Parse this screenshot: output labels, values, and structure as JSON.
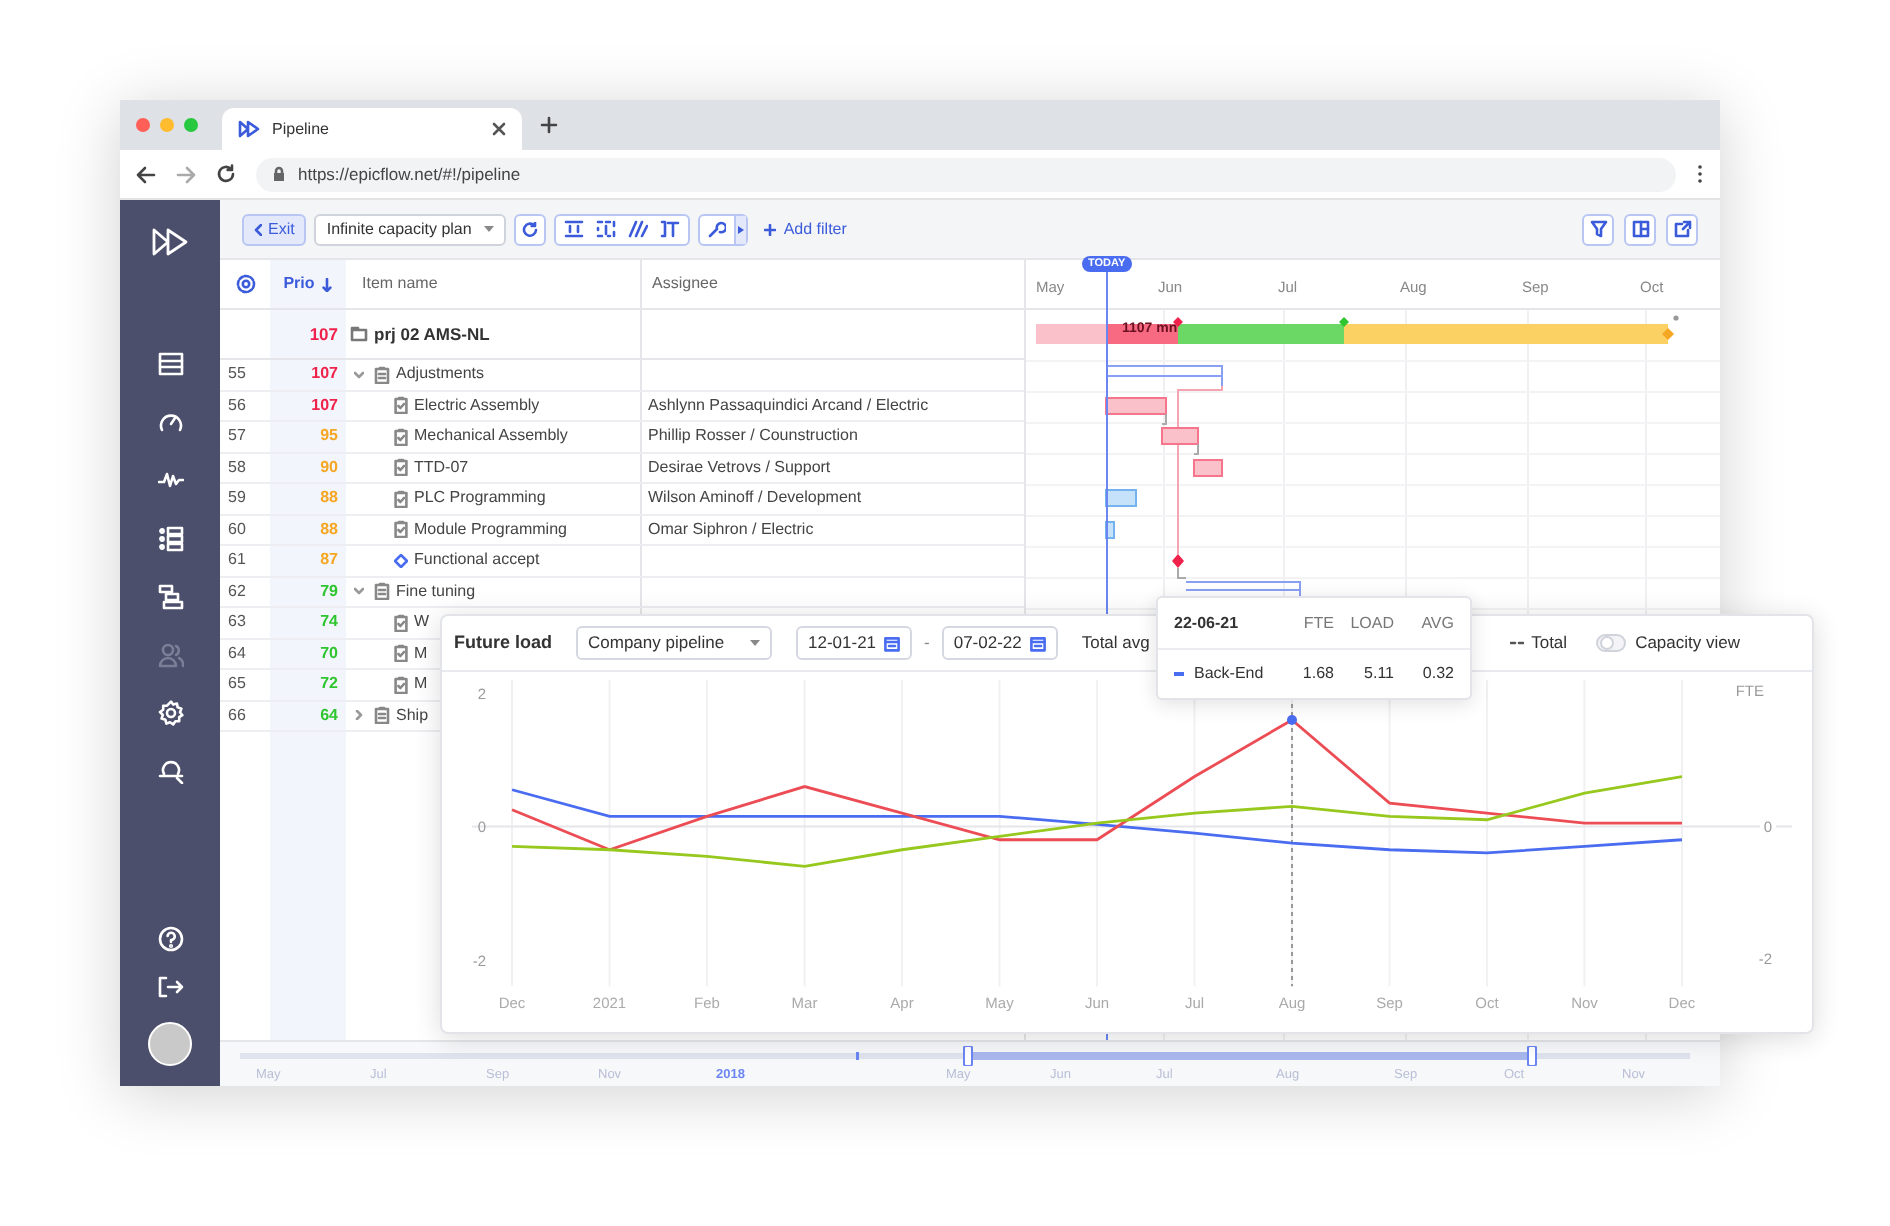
{
  "browser": {
    "tab_title": "Pipeline",
    "url": "https://epicflow.net/#!/pipeline"
  },
  "sidebar": {
    "items": [
      {
        "kind": "list",
        "disabled": false
      },
      {
        "kind": "gauge",
        "disabled": false
      },
      {
        "kind": "pulse",
        "disabled": false
      },
      {
        "kind": "checklist",
        "disabled": false
      },
      {
        "kind": "hierarchy",
        "disabled": false
      },
      {
        "kind": "users",
        "disabled": true
      },
      {
        "kind": "gear",
        "disabled": false
      },
      {
        "kind": "inspect",
        "disabled": false
      }
    ]
  },
  "toolbar": {
    "exit": "Exit",
    "plan_select": "Infinite capacity plan",
    "add_filter": "Add filter"
  },
  "table": {
    "columns": [
      "Prio",
      "Item name",
      "Assignee"
    ],
    "project": {
      "prio": "107",
      "color": "#f0224b",
      "name": "prj 02 AMS-NL"
    },
    "rows": [
      {
        "number": "55",
        "prio": "107",
        "color": "#f0224b",
        "kind": "group",
        "expanded": true,
        "name": "Adjustments"
      },
      {
        "number": "56",
        "prio": "107",
        "color": "#f0224b",
        "kind": "task",
        "name": "Electric Assembly",
        "assignee": "Ashlynn Passaquindici Arcand / Electric"
      },
      {
        "number": "57",
        "prio": "95",
        "color": "#f5a623",
        "kind": "task",
        "name": "Mechanical Assembly",
        "assignee": "Phillip Rosser / Counstruction"
      },
      {
        "number": "58",
        "prio": "90",
        "color": "#f5a623",
        "kind": "task",
        "name": "TTD-07",
        "assignee": "Desirae Vetrovs / Support"
      },
      {
        "number": "59",
        "prio": "88",
        "color": "#f5a623",
        "kind": "task",
        "name": "PLC Programming",
        "assignee": "Wilson Aminoff / Development"
      },
      {
        "number": "60",
        "prio": "88",
        "color": "#f5a623",
        "kind": "task",
        "name": "Module Programming",
        "assignee": "Omar Siphron / Electric"
      },
      {
        "number": "61",
        "prio": "87",
        "color": "#f5a623",
        "kind": "milestone",
        "name": "Functional accept"
      },
      {
        "number": "62",
        "prio": "79",
        "color": "#2fc52f",
        "kind": "group",
        "expanded": true,
        "name": "Fine tuning"
      },
      {
        "number": "63",
        "prio": "74",
        "color": "#2fc52f",
        "kind": "task",
        "name": "W"
      },
      {
        "number": "64",
        "prio": "70",
        "color": "#2fc52f",
        "kind": "task",
        "name": "M"
      },
      {
        "number": "65",
        "prio": "72",
        "color": "#2fc52f",
        "kind": "task",
        "name": "M"
      },
      {
        "number": "66",
        "prio": "64",
        "color": "#2fc52f",
        "kind": "group",
        "expanded": false,
        "name": "Ship"
      }
    ]
  },
  "gantt": {
    "months": [
      "May",
      "Jun",
      "Jul",
      "Aug",
      "Sep",
      "Oct"
    ],
    "today": "TODAY",
    "bar_label": "1107 mn"
  },
  "timeline": {
    "labels": [
      "May",
      "Jul",
      "Sep",
      "Nov",
      "2018",
      "May",
      "Jun",
      "Jul",
      "Aug",
      "Sep",
      "Oct",
      "Nov"
    ]
  },
  "future_load": {
    "title": "Future load",
    "select": "Company pipeline",
    "date_from": "12-01-21",
    "separator": "-",
    "date_to": "07-02-22",
    "total_avg": "Total avg",
    "legend_total": "Total",
    "capacity_view": {
      "label": "Capacity view",
      "on": false
    },
    "unit": "FTE",
    "right_ticks": [
      "0",
      "-2"
    ],
    "chart_data": {
      "type": "line",
      "categories": [
        "Dec",
        "2021",
        "Feb",
        "Mar",
        "Apr",
        "May",
        "Jun",
        "Jul",
        "Aug",
        "Sep",
        "Oct",
        "Nov",
        "Dec"
      ],
      "ylim": [
        -3.13,
        3.18
      ],
      "grid": true,
      "yticks": [
        -2,
        0,
        2
      ],
      "series": [
        {
          "color": "#4a6cf0",
          "values": [
            0.55,
            0.15,
            0.15,
            0.15,
            0.15,
            0.15,
            0.03,
            -0.1,
            -0.25,
            -0.35,
            -0.4,
            -0.3,
            -0.2
          ]
        },
        {
          "color": "#ec4d55",
          "values": [
            0.25,
            -0.35,
            0.15,
            0.6,
            0.2,
            -0.2,
            -0.2,
            0.75,
            1.6,
            0.35,
            0.2,
            0.05,
            0.05
          ]
        },
        {
          "color": "#96c81e",
          "values": [
            -0.3,
            -0.35,
            -0.45,
            -0.6,
            -0.35,
            -0.15,
            0.05,
            0.2,
            0.3,
            0.15,
            0.1,
            0.5,
            0.75
          ]
        }
      ],
      "ref_lines": [
        {
          "axis": "x",
          "value": "Aug"
        }
      ]
    }
  },
  "tooltip": {
    "date": "22-06-21",
    "columns": [
      "FTE",
      "LOAD",
      "AVG"
    ],
    "rows": [
      {
        "name": "Back-End",
        "color": "#4a6cf0",
        "values": [
          "1.68",
          "5.11",
          "0.32"
        ]
      }
    ]
  }
}
